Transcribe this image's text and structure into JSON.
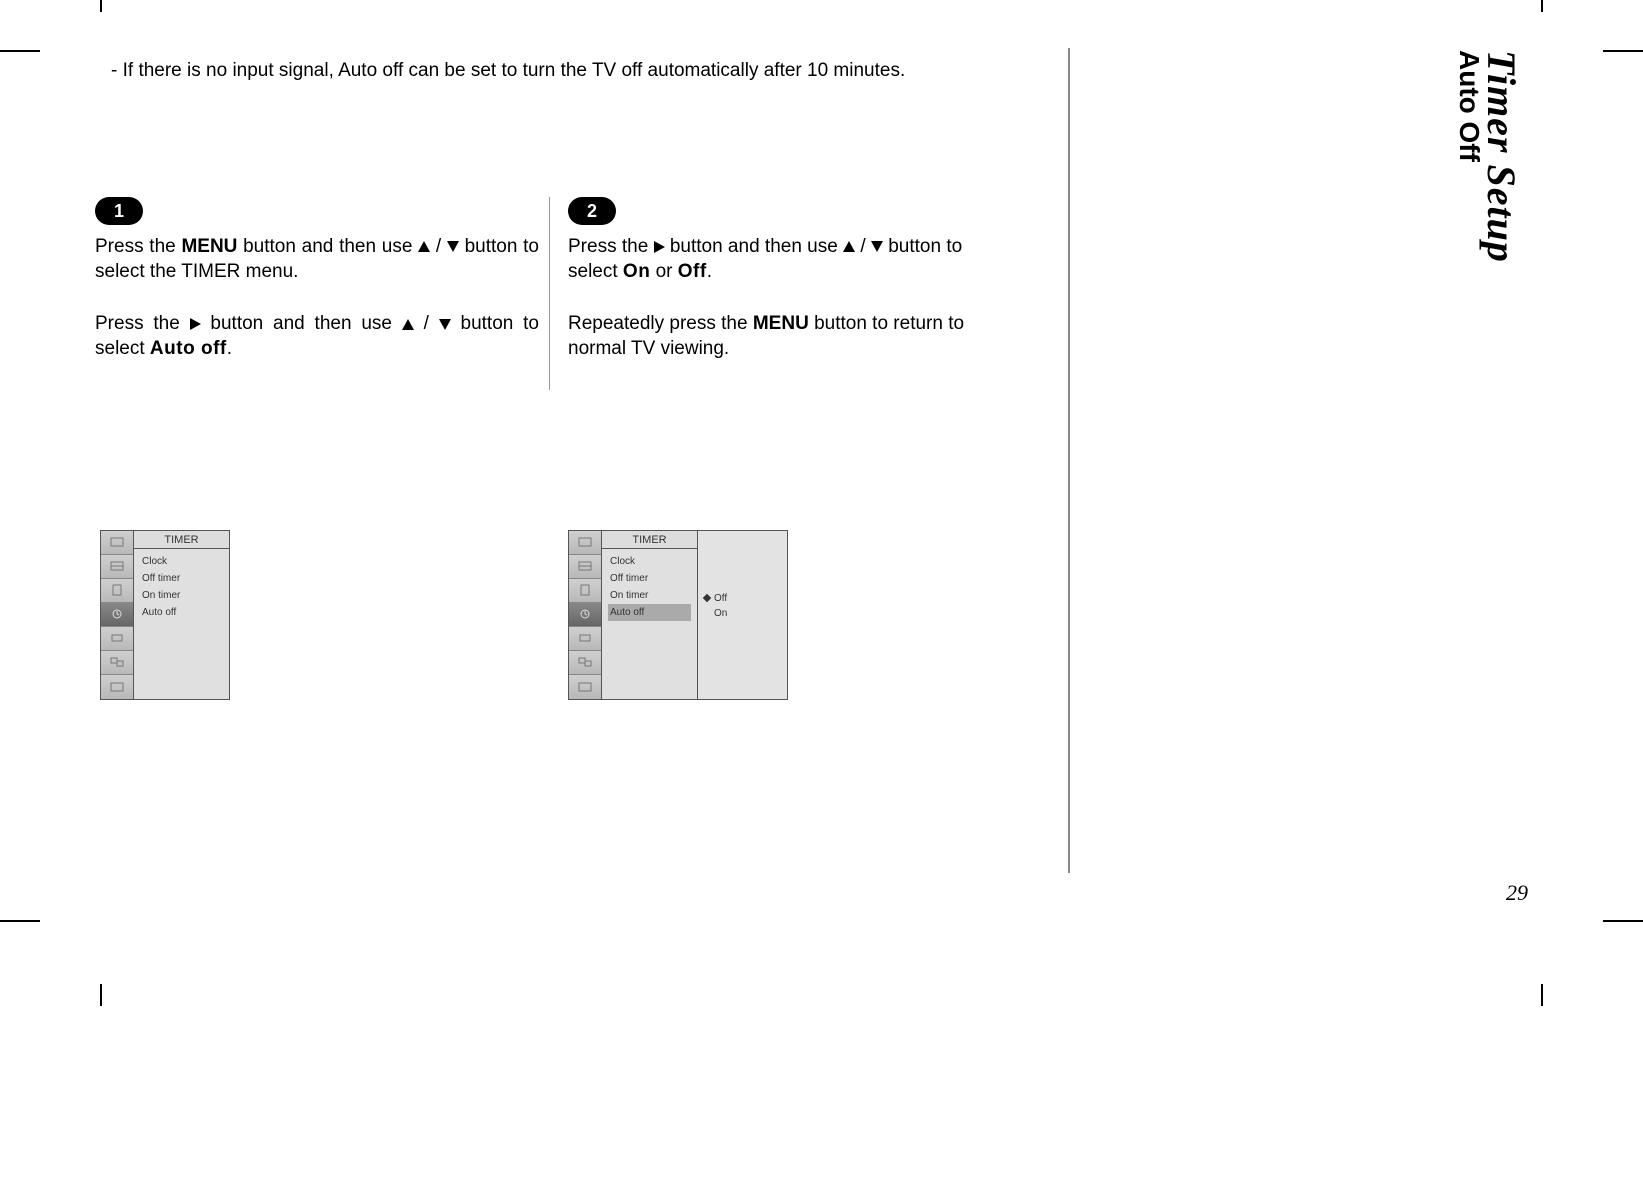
{
  "intro": "-   If there is no input signal, Auto off can be set to turn the TV off automatically after 10 minutes.",
  "steps": {
    "s1": {
      "num": "1",
      "p1_a": "Press the ",
      "p1_menu": "MENU",
      "p1_b": " button and then use ",
      "p1_c": " / ",
      "p1_d": " button to select the TIMER menu.",
      "p2_a": "Press the ",
      "p2_b": " button and then use ",
      "p2_c": " / ",
      "p2_d": " button to select ",
      "p2_auto": "Auto off",
      "p2_e": "."
    },
    "s2": {
      "num": "2",
      "p1_a": "Press the ",
      "p1_b": " button and then use ",
      "p1_c": " / ",
      "p1_d": " button to select ",
      "p1_on": "On",
      "p1_or": " or ",
      "p1_off": "Off",
      "p1_e": ".",
      "p2_a": "Repeatedly press the ",
      "p2_menu": "MENU",
      "p2_b": " button to return to normal TV viewing."
    }
  },
  "osd": {
    "title": "TIMER",
    "items": {
      "clock": "Clock",
      "offtimer": "Off timer",
      "ontimer": "On timer",
      "autooff": "Auto off"
    },
    "options": {
      "off": "Off",
      "on": "On"
    }
  },
  "sidetab": {
    "title": "Timer Setup",
    "sub": "Auto Off"
  },
  "pagenum": "29"
}
